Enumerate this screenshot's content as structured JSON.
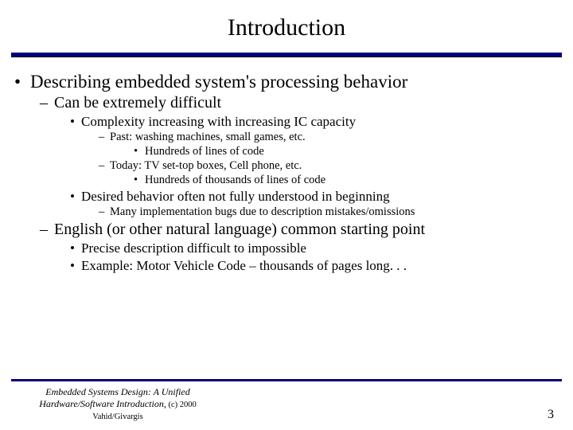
{
  "title": "Introduction",
  "bullets": {
    "l1_1": "Describing embedded system's processing behavior",
    "l2_1": "Can be extremely difficult",
    "l3_1": "Complexity increasing with increasing IC capacity",
    "l4_1": "Past: washing machines, small games, etc.",
    "l5_1": "Hundreds of lines of code",
    "l4_2": "Today: TV set-top boxes, Cell phone, etc.",
    "l5_2": "Hundreds of thousands of lines of code",
    "l3_2": "Desired behavior often not fully understood in beginning",
    "l4_3": "Many implementation bugs due to description mistakes/omissions",
    "l2_2": "English (or other natural language) common starting point",
    "l3_3": "Precise description difficult to impossible",
    "l3_4": "Example: Motor Vehicle Code – thousands of pages long. . ."
  },
  "footer": {
    "book_title": "Embedded Systems Design: A Unified Hardware/Software Introduction,",
    "copyright": " (c) 2000 Vahid/Givargis",
    "page_number": "3"
  }
}
